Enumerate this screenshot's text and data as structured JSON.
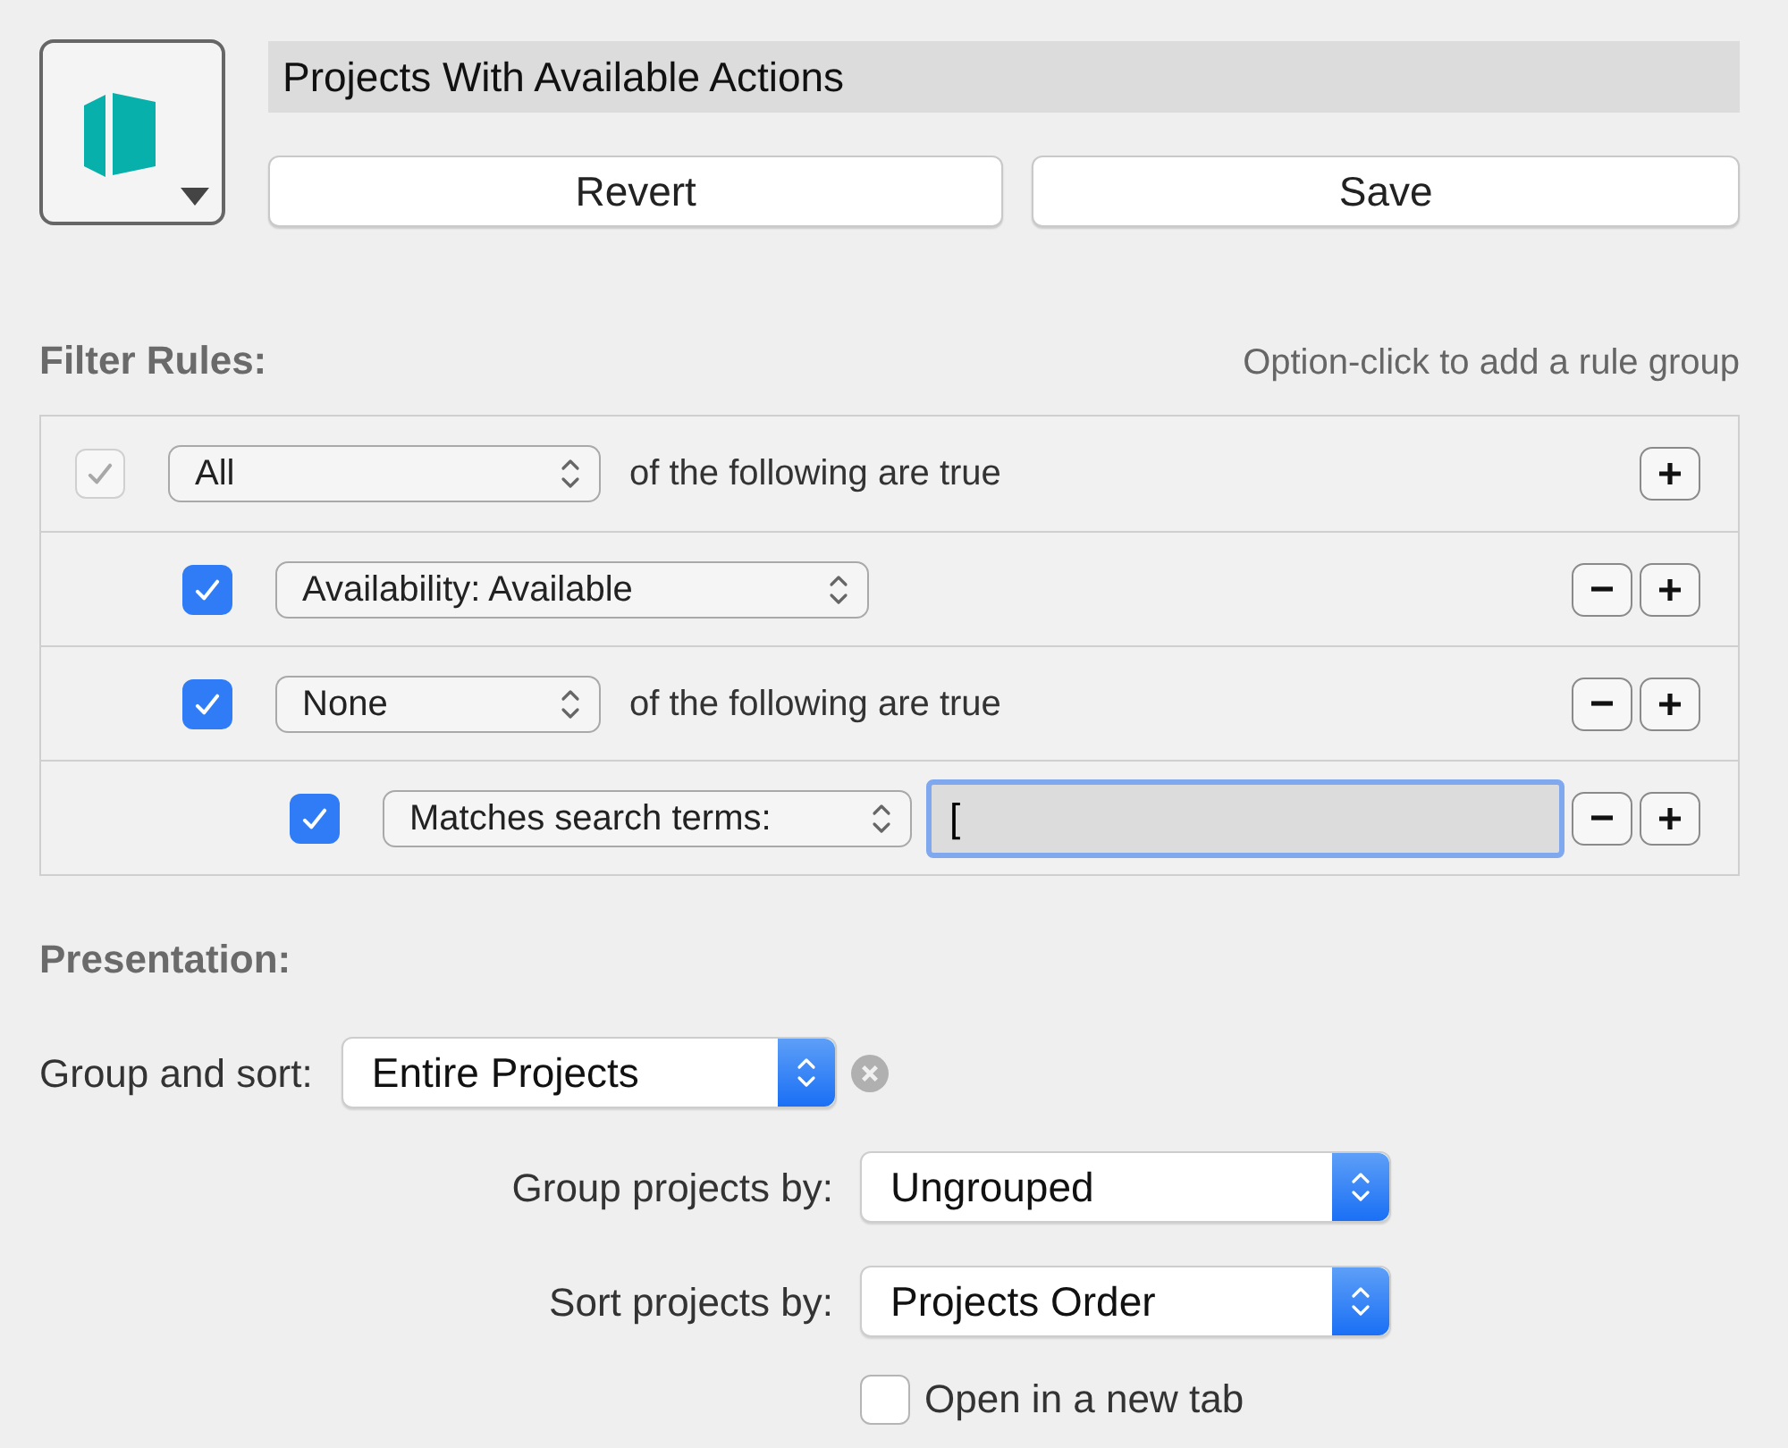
{
  "perspective": {
    "title": "Projects With Available Actions",
    "buttons": [
      "Revert",
      "Save"
    ]
  },
  "filter_rules": {
    "heading": "Filter Rules:",
    "hint": "Option-click to add a rule group",
    "rules": [
      {
        "kind": "group",
        "checked": true,
        "disabled": true,
        "select": "All",
        "text": "of the following are true",
        "removable": false,
        "children": [
          {
            "kind": "condition",
            "checked": true,
            "disabled": false,
            "select": "Availability: Available",
            "removable": true
          },
          {
            "kind": "group",
            "checked": true,
            "disabled": false,
            "select": "None",
            "text": "of the following are true",
            "removable": true,
            "children": [
              {
                "kind": "search",
                "checked": true,
                "disabled": false,
                "select": "Matches search terms:",
                "value": "[",
                "focused": true,
                "removable": true
              }
            ]
          }
        ]
      }
    ]
  },
  "presentation": {
    "heading": "Presentation:",
    "settings": [
      {
        "label": "Group and sort:",
        "value": "Entire Projects",
        "clearable": true
      },
      {
        "label": "Group projects by:",
        "value": "Ungrouped",
        "clearable": false
      },
      {
        "label": "Sort projects by:",
        "value": "Projects Order",
        "clearable": false
      }
    ],
    "open_in_new_tab": {
      "label": "Open in a new tab",
      "checked": false
    }
  }
}
